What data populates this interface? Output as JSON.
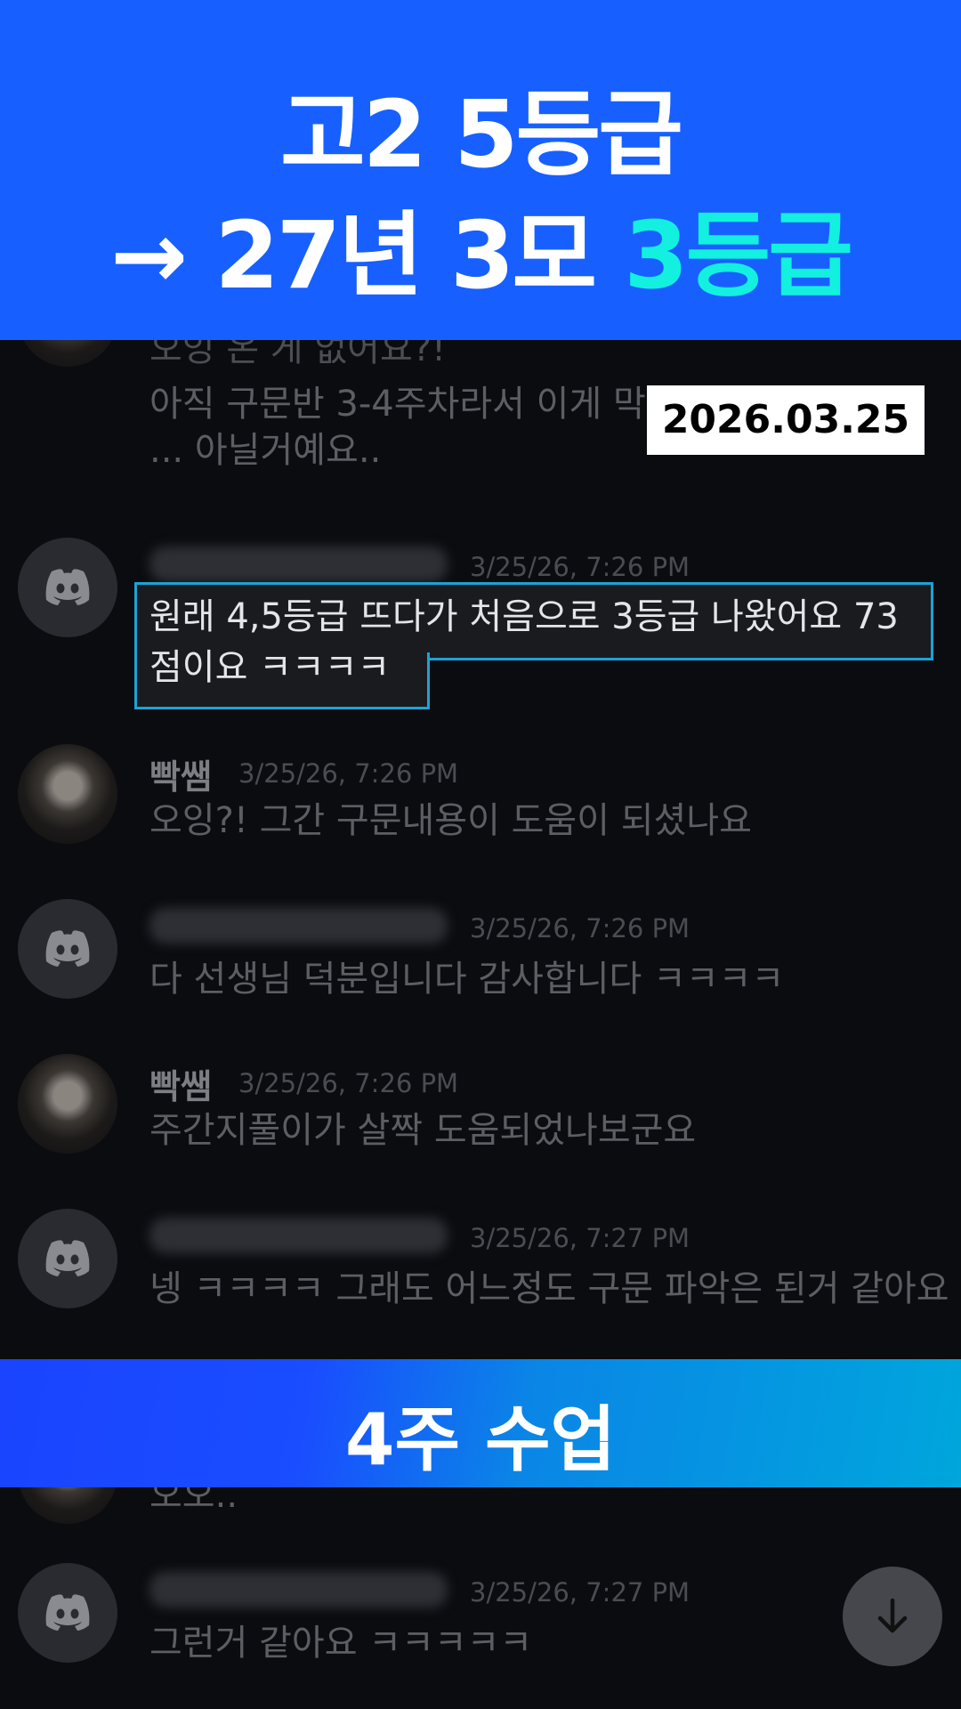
{
  "headline": {
    "line1": "고2 5등급",
    "line2_prefix": "→ 27년 3모 ",
    "line2_accent": "3등급"
  },
  "date_badge": "2026.03.25",
  "band_label": "4주 수업",
  "messages": [
    {
      "text": "오잉 온 게 없어요?!"
    },
    {
      "text": "아직 구문반 3-4주차라서 이게 막 ... 아닐거예요.."
    },
    {
      "name": "",
      "time": "3/25/26, 7:26 PM",
      "line1": "원래 4,5등급 뜨다가 처음으로 3등급 나왔어요 73",
      "line2": "점이요 ㅋㅋㅋㅋ"
    },
    {
      "name": "빡쌤",
      "time": "3/25/26, 7:26 PM",
      "text": "오잉?! 그간 구문내용이 도움이 되셨나요"
    },
    {
      "name": "",
      "time": "3/25/26, 7:26 PM",
      "text": "다 선생님 덕분입니다 감사합니다 ㅋㅋㅋㅋ"
    },
    {
      "name": "빡쌤",
      "time": "3/25/26, 7:26 PM",
      "text": "주간지풀이가 살짝 도움되었나보군요"
    },
    {
      "name": "",
      "time": "3/25/26, 7:27 PM",
      "text": "넹 ㅋㅋㅋㅋ 그래도 어느정도 구문 파악은 된거 같아요"
    },
    {
      "text": "오오.."
    },
    {
      "name": "",
      "time": "3/25/26, 7:27 PM",
      "text": "그런거 같아요 ㅋㅋㅋㅋㅋ"
    }
  ],
  "colors": {
    "brand_blue": "#1760ff",
    "accent_cyan": "#13f0e0",
    "highlight_border": "#1ba3d6"
  },
  "icons": {
    "avatar_discord": "discord-icon",
    "scroll_button": "arrow-down-icon"
  }
}
